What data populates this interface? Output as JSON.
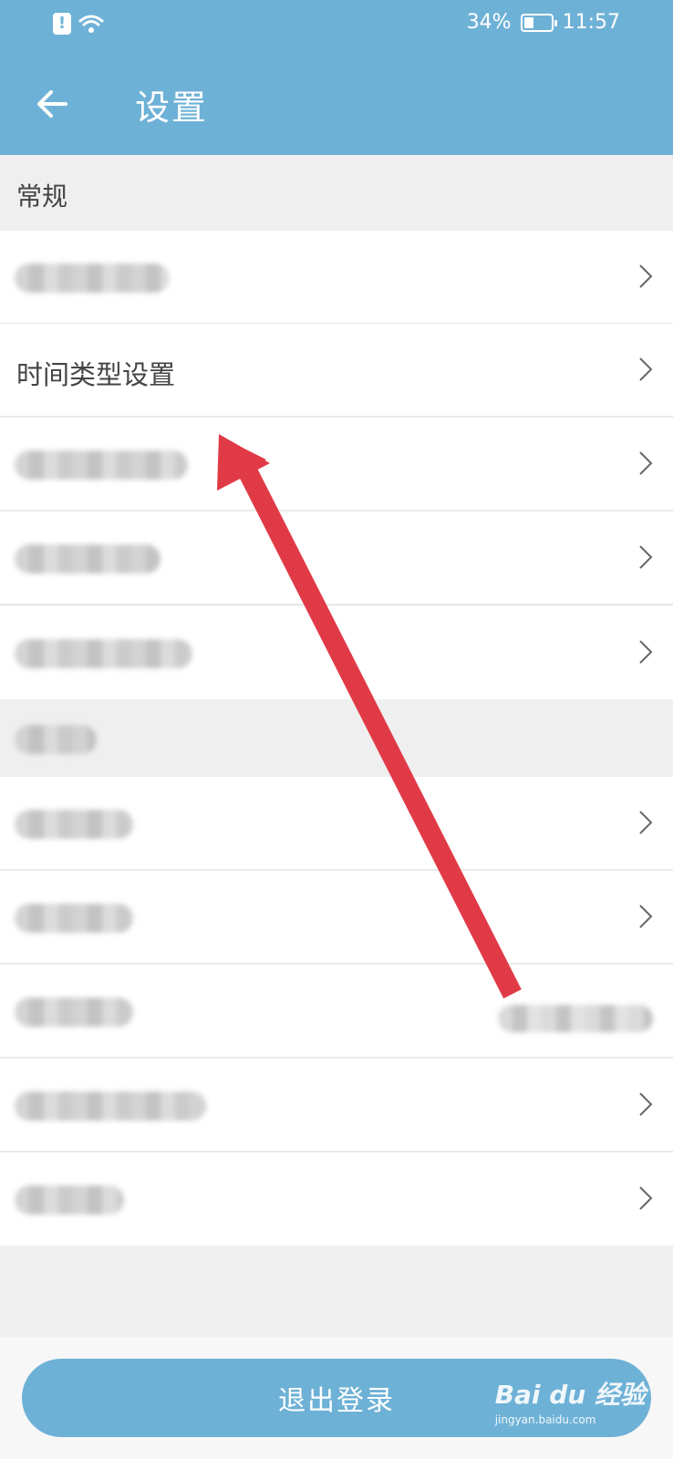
{
  "status_bar": {
    "battery": "34%",
    "battery_level": 0.34,
    "time": "11:57"
  },
  "header": {
    "title": "设置"
  },
  "sections": [
    {
      "title": "常规",
      "items": [
        {
          "label": "",
          "blurred": true
        },
        {
          "label": "时间类型设置",
          "blurred": false
        },
        {
          "label": "",
          "blurred": true
        },
        {
          "label": "",
          "blurred": true
        },
        {
          "label": "",
          "blurred": true
        }
      ]
    },
    {
      "title": "",
      "items": [
        {
          "label": "",
          "blurred": true
        },
        {
          "label": "",
          "blurred": true
        },
        {
          "label": "",
          "blurred": true
        },
        {
          "label": "",
          "blurred": true
        },
        {
          "label": "",
          "blurred": true
        }
      ]
    }
  ],
  "logout_label": "退出登录",
  "watermark": {
    "brand": "Bai du 经验",
    "url": "jingyan.baidu.com"
  },
  "colors": {
    "accent": "#6eb1d6",
    "annotation_arrow": "#e13a47"
  }
}
